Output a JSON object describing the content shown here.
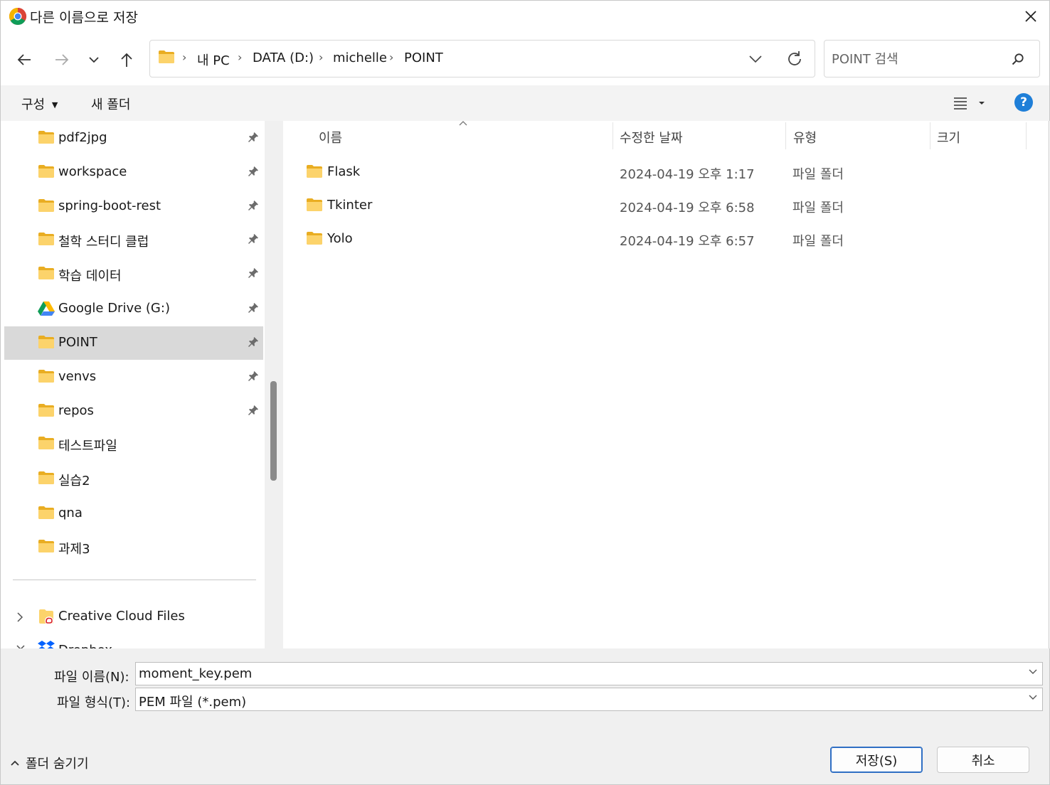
{
  "title": "다른 이름으로 저장",
  "breadcrumb": [
    "내 PC",
    "DATA (D:)",
    "michelle",
    "POINT"
  ],
  "search": {
    "placeholder": "POINT 검색"
  },
  "toolbar": {
    "organize": "구성",
    "new_folder": "새 폴더"
  },
  "nav": {
    "items": [
      {
        "label": "pdf2jpg",
        "icon": "folder-icon",
        "pinned": true
      },
      {
        "label": "workspace",
        "icon": "folder-icon",
        "pinned": true
      },
      {
        "label": "spring-boot-rest",
        "icon": "folder-icon",
        "pinned": true
      },
      {
        "label": "철학 스터디 클럽",
        "icon": "folder-icon",
        "pinned": true
      },
      {
        "label": "학습 데이터",
        "icon": "folder-icon",
        "pinned": true
      },
      {
        "label": "Google Drive (G:)",
        "icon": "google-drive-icon",
        "pinned": true
      },
      {
        "label": "POINT",
        "icon": "folder-icon",
        "pinned": true,
        "selected": true
      },
      {
        "label": "venvs",
        "icon": "folder-icon",
        "pinned": true
      },
      {
        "label": "repos",
        "icon": "folder-icon",
        "pinned": true
      },
      {
        "label": "테스트파일",
        "icon": "folder-icon",
        "pinned": false
      },
      {
        "label": "실습2",
        "icon": "folder-icon",
        "pinned": false
      },
      {
        "label": "qna",
        "icon": "folder-icon",
        "pinned": false
      },
      {
        "label": "과제3",
        "icon": "folder-icon",
        "pinned": false
      }
    ],
    "creative_cloud": "Creative Cloud Files",
    "dropbox": "Dropbox"
  },
  "columns": {
    "name": "이름",
    "modified": "수정한 날짜",
    "type": "유형",
    "size": "크기"
  },
  "files": [
    {
      "name": "Flask",
      "modified": "2024-04-19 오후 1:17",
      "type": "파일 폴더"
    },
    {
      "name": "Tkinter",
      "modified": "2024-04-19 오후 6:58",
      "type": "파일 폴더"
    },
    {
      "name": "Yolo",
      "modified": "2024-04-19 오후 6:57",
      "type": "파일 폴더"
    }
  ],
  "form": {
    "filename_label": "파일 이름(N):",
    "filename_value": "moment_key.pem",
    "filetype_label": "파일 형식(T):",
    "filetype_value": "PEM 파일 (*.pem)"
  },
  "footer": {
    "hide_folders": "폴더 숨기기",
    "save": "저장(S)",
    "cancel": "취소"
  },
  "colors": {
    "folder": "#f6c543",
    "selected": "#d9d9d9",
    "accent": "#1f7fd8"
  }
}
